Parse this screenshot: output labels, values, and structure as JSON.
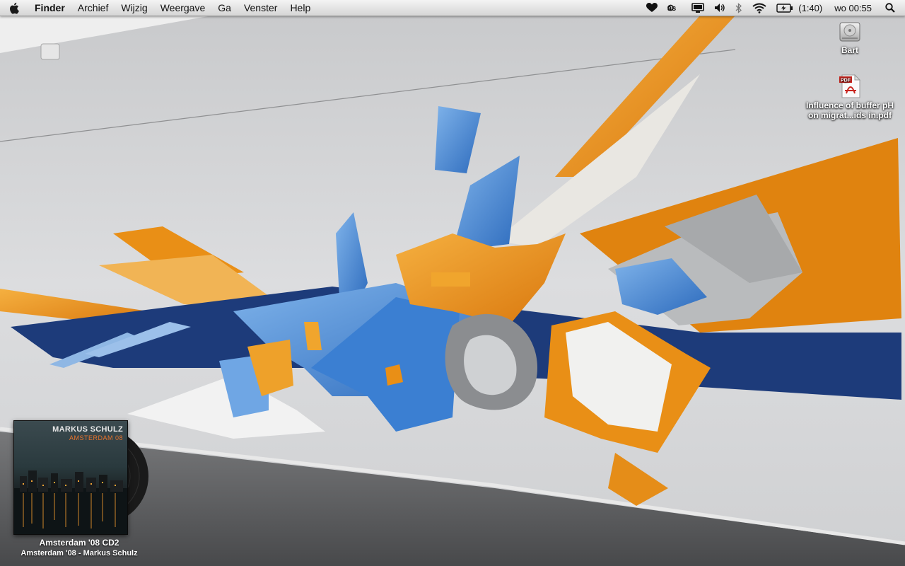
{
  "menubar": {
    "app_name": "Finder",
    "menus": [
      "Archief",
      "Wijzig",
      "Weergave",
      "Ga",
      "Venster",
      "Help"
    ],
    "status": {
      "battery_text": "(1:40)",
      "clock": "wo 00:55"
    }
  },
  "desktop": {
    "icons": [
      {
        "label": "Bart",
        "icon": "hard-drive-icon"
      },
      {
        "label_line1": "Influence of buffer pH",
        "label_line2": "on migrat...ids in.pdf",
        "icon": "pdf-document-icon",
        "badge": "PDF"
      }
    ]
  },
  "album_widget": {
    "cover_artist": "MARKUS SCHULZ",
    "cover_title": "AMSTERDAM 08",
    "album_name": "Amsterdam '08 CD2",
    "album_subtitle": "Amsterdam '08 - Markus Schulz"
  },
  "colors": {
    "orange": "#e98f16",
    "blue": "#4a8fd6",
    "navy": "#1d3b7a",
    "wall": "#d7d8da",
    "floor": "#5a5b5d"
  }
}
